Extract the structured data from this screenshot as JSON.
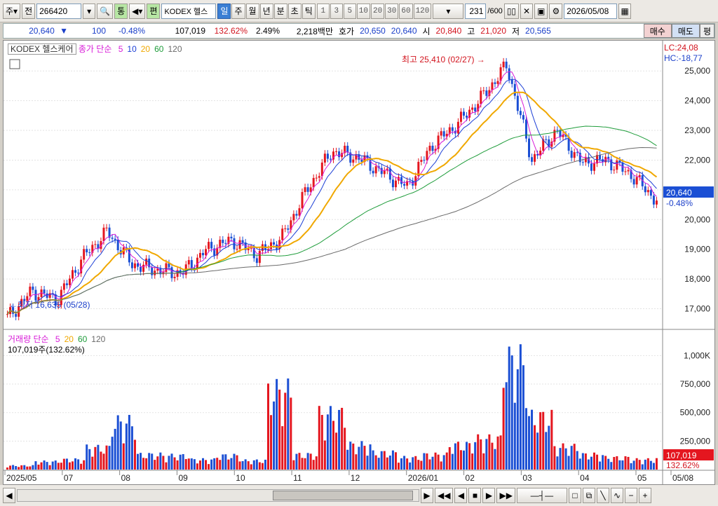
{
  "toolbar": {
    "market": "주",
    "mode": "전",
    "code": "266420",
    "tong_label": "통",
    "edit_label": "편",
    "name": "KODEX 헬스",
    "periods": [
      "일",
      "주",
      "월",
      "년",
      "분",
      "초",
      "틱"
    ],
    "active_period": "일",
    "intervals": [
      "1",
      "3",
      "5",
      "10",
      "20",
      "30",
      "60",
      "120"
    ],
    "count": "231",
    "count_total": "/600",
    "date": "2026/05/08"
  },
  "quote": {
    "price": "20,640",
    "change": "100",
    "change_pct": "-0.48%",
    "volume": "107,019",
    "vol_ratio": "132.62%",
    "turnover": "2.49%",
    "amount": "2,218백만",
    "bid_label": "호가",
    "ask": "20,650",
    "bid": "20,640",
    "open_label": "시",
    "open": "20,840",
    "high_label": "고",
    "high": "21,020",
    "low_label": "저",
    "low": "20,565",
    "buy_label": "매수",
    "sell_label": "매도",
    "eval_label": "평"
  },
  "price_legend": {
    "name": "KODEX 헬스케어",
    "indicator": "종가 단순",
    "periods": [
      "5",
      "10",
      "20",
      "60",
      "120"
    ],
    "colors": [
      "#d81bd8",
      "#1c3fd6",
      "#f0a800",
      "#1e9c3a",
      "#6a6a6a"
    ]
  },
  "volume_legend": {
    "name": "거래량 단순",
    "periods": [
      "5",
      "20",
      "60",
      "120"
    ],
    "colors": [
      "#d81bd8",
      "#f0a800",
      "#1e9c3a",
      "#6a6a6a"
    ],
    "current": "107,019주(132.62%)"
  },
  "annotations": {
    "high": "최고 25,410 (02/27)",
    "low": "최저 16,635 (05/28)",
    "lc": "LC:24,08",
    "hc": "HC:-18,77",
    "last_price": "20,640",
    "last_pct": "-0.48%",
    "last_volume": "107,019",
    "last_vol_pct": "132.62%"
  },
  "chart_data": {
    "type": "line",
    "title": "KODEX 헬스케어",
    "price_axis": {
      "ticks": [
        "25,000",
        "24,000",
        "23,000",
        "22,000",
        "21,000",
        "20,000",
        "19,000",
        "18,000",
        "17,000"
      ],
      "ylim": [
        16400,
        25500
      ]
    },
    "volume_axis": {
      "ticks": [
        "1,000K",
        "750,000",
        "500,000",
        "250,000"
      ],
      "ylim": [
        0,
        1150000
      ]
    },
    "x_labels": [
      "2025/05",
      "07",
      "08",
      "09",
      "10",
      "11",
      "12",
      "2026/01",
      "02",
      "03",
      "04",
      "05",
      "05/08"
    ],
    "close": [
      16700,
      17600,
      17300,
      18700,
      19600,
      18500,
      18300,
      18200,
      19000,
      19300,
      18800,
      19400,
      21000,
      22300,
      22100,
      21600,
      21100,
      22500,
      23200,
      24100,
      25200,
      22000,
      23000,
      21900,
      22000,
      21500,
      20640
    ],
    "volume": [
      40000,
      80000,
      100000,
      220000,
      480000,
      150000,
      140000,
      100000,
      140000,
      90000,
      800000,
      150000,
      560000,
      250000,
      170000,
      120000,
      150000,
      250000,
      310000,
      1100000,
      530000,
      230000,
      150000,
      120000,
      100000,
      107019
    ]
  }
}
